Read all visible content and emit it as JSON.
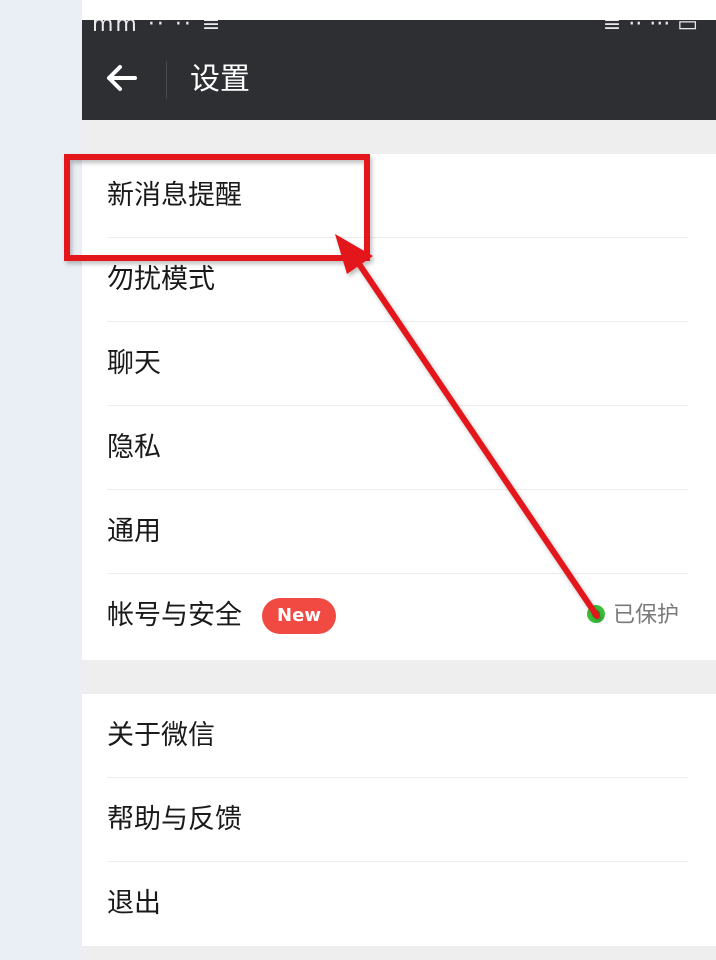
{
  "status_bar": {
    "left_text": "mm ·· ·· ≡",
    "right_text": "≡ ·· ··· ▭"
  },
  "header": {
    "back_icon": "arrow-left-icon",
    "title": "设置"
  },
  "group1": {
    "items": [
      {
        "label": "新消息提醒"
      },
      {
        "label": "勿扰模式"
      },
      {
        "label": "聊天"
      },
      {
        "label": "隐私"
      },
      {
        "label": "通用"
      },
      {
        "label": "帐号与安全",
        "badge": "New",
        "status": "已保护"
      }
    ]
  },
  "group2": {
    "items": [
      {
        "label": "关于微信"
      },
      {
        "label": "帮助与反馈"
      },
      {
        "label": "退出"
      }
    ]
  },
  "colors": {
    "title_bar": "#2e2f33",
    "background": "#eeeeee",
    "badge": "#f04a43",
    "protected_dot": "#3cbf3a",
    "annotation": "#e3191f"
  },
  "annotation": {
    "type": "red-box-and-arrow",
    "target": "新消息提醒",
    "from": "已保护"
  }
}
